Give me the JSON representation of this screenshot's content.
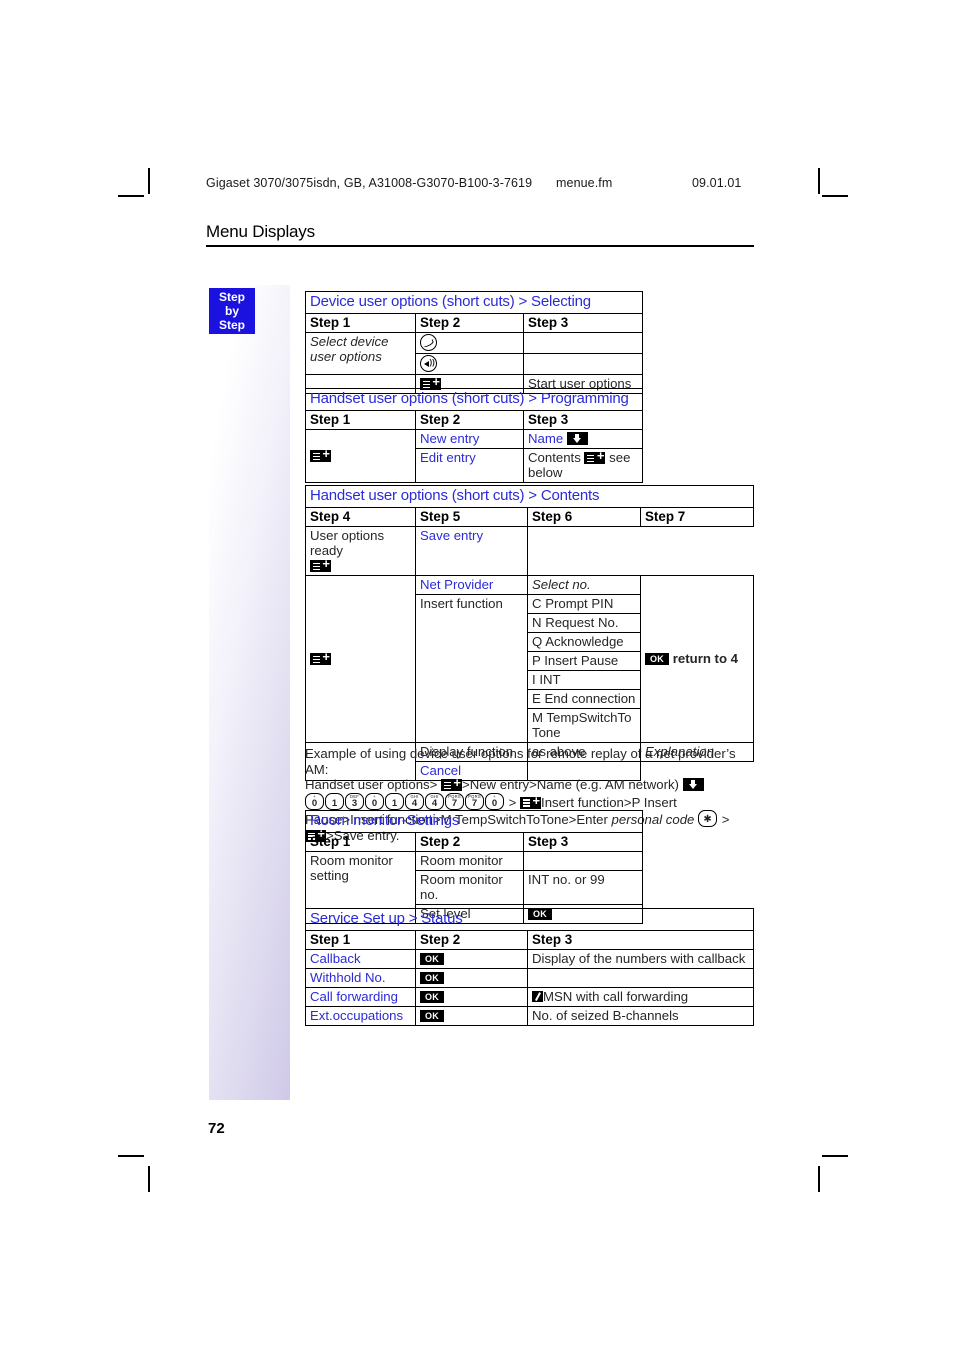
{
  "runhead": {
    "document": "Gigaset 3070/3075isdn, GB, A31008-G3070-B100-3-7619",
    "file": "menue.fm",
    "date": "09.01.01"
  },
  "chapter_title": "Menu Displays",
  "sidebar": {
    "badge_line1": "Step",
    "badge_line2": "by",
    "badge_line3": "Step",
    "page_number": "72"
  },
  "tables": [
    {
      "caption": "Device user options (short cuts) > Selecting",
      "headers": [
        "Step 1",
        "Step 2",
        "Step 3"
      ],
      "rows": [
        [
          "Select device user options",
          "hook-icon",
          ""
        ],
        [
          "",
          "speaker-icon",
          ""
        ],
        [
          "",
          "menu-icon",
          "Start user options"
        ]
      ]
    },
    {
      "caption": "Handset user options (short cuts) > Programming",
      "headers": [
        "Step 1",
        "Step 2",
        "Step 3"
      ],
      "rows": [
        [
          "",
          "New entry",
          "Name"
        ],
        [
          "menu-icon",
          "Edit entry",
          "Contents"
        ]
      ],
      "cell_notes": {
        "contents_suffix": "see below"
      }
    },
    {
      "caption": "Handset user options (short cuts) > Contents",
      "headers": [
        "Step 4",
        "Step 5",
        "Step 6",
        "Step 7"
      ],
      "step4_label": "User options ready",
      "rows": [
        {
          "step5": "Save entry",
          "step6": ""
        },
        {
          "step5": "Net Provider",
          "step6": "Select no."
        },
        {
          "step5": "Insert function",
          "step6": "C Prompt PIN"
        },
        {
          "step5": "",
          "step6": "N Request No."
        },
        {
          "step5": "",
          "step6": "Q Acknowledge"
        },
        {
          "step5": "",
          "step6": "P Insert Pause"
        },
        {
          "step5": "",
          "step6": "I INT"
        },
        {
          "step5": "",
          "step6": "E End connection"
        },
        {
          "step5": "",
          "step6": "M TempSwitchTo Tone"
        },
        {
          "step5": "Display function",
          "step6": "as above",
          "step7": "Explanation"
        },
        {
          "step5": "Cancel",
          "step6": ""
        }
      ],
      "step7_return": "return to 4",
      "step7_ok": "OK"
    },
    {
      "caption": "Room monitor-Settings",
      "headers": [
        "Step 1",
        "Step 2",
        "Step 3"
      ],
      "step1_label": "Room monitor setting",
      "rows": [
        [
          "Room monitor",
          ""
        ],
        [
          "Room monitor no.",
          "INT no. or 99"
        ],
        [
          "Set level",
          "OK"
        ]
      ]
    },
    {
      "caption": "Service Set up > Status",
      "headers": [
        "Step 1",
        "Step 2",
        "Step 3"
      ],
      "rows": [
        {
          "step1": "Callback",
          "step2": "OK",
          "step3": "Display of the numbers with callback"
        },
        {
          "step1": "Withhold No.",
          "step2": "OK",
          "step3": ""
        },
        {
          "step1": "Call forwarding",
          "step2": "OK",
          "step3": "MSN with call forwarding",
          "step3_icon": "check-icon"
        },
        {
          "step1": "Ext.occupations",
          "step2": "OK",
          "step3": "No. of seized B-channels"
        }
      ]
    }
  ],
  "example": {
    "line1": "Example of using device user options for remote replay of a net provider’s AM:",
    "seg_a": "Handset user options>",
    "seg_b": ">New entry>Name (e.g. AM network)",
    "keys": [
      {
        "digit": "0",
        "letters": "+"
      },
      {
        "digit": "1",
        "letters": ""
      },
      {
        "digit": "3",
        "letters": "DEF"
      },
      {
        "digit": "0",
        "letters": "+"
      },
      {
        "digit": "1",
        "letters": ""
      },
      {
        "digit": "4",
        "letters": "GHI"
      },
      {
        "digit": "4",
        "letters": "GHI"
      },
      {
        "digit": "7",
        "letters": "PQRS"
      },
      {
        "digit": "7",
        "letters": "PQRS"
      },
      {
        "digit": "0",
        "letters": "+"
      }
    ],
    "seg_c": ">",
    "seg_d": "Insert function>P Insert Pause>Insert function>M TempSwitchToTone>Enter",
    "seg_e": "personal code",
    "star_key": "✱",
    "seg_f": ">",
    "seg_g": ">Save entry."
  },
  "colors": {
    "link_blue": "#2b2bd8",
    "badge_blue": "#1b12e0",
    "band_end": "#cfc9e8",
    "text": "#262626"
  }
}
